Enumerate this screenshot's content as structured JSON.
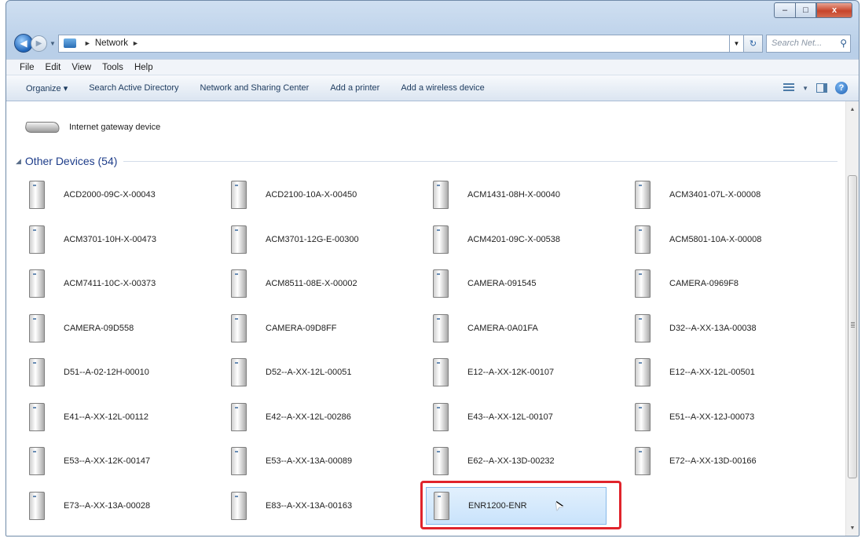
{
  "window": {
    "minimize_label": "–",
    "maximize_label": "□",
    "close_label": "x"
  },
  "address_bar": {
    "path_root_sep": "►",
    "location": "Network",
    "trailing_sep": "►",
    "search_placeholder": "Search Net..."
  },
  "menu": [
    "File",
    "Edit",
    "View",
    "Tools",
    "Help"
  ],
  "commands": [
    "Organize ▾",
    "Search Active Directory",
    "Network and Sharing Center",
    "Add a printer",
    "Add a wireless device"
  ],
  "gateway": {
    "label": "Internet gateway device"
  },
  "group": {
    "title": "Other Devices (54)",
    "chevron": "◢"
  },
  "devices": [
    "ACD2000-09C-X-00043",
    "ACD2100-10A-X-00450",
    "ACM1431-08H-X-00040",
    "ACM3401-07L-X-00008",
    "ACM3701-10H-X-00473",
    "ACM3701-12G-E-00300",
    "ACM4201-09C-X-00538",
    "ACM5801-10A-X-00008",
    "ACM7411-10C-X-00373",
    "ACM8511-08E-X-00002",
    "CAMERA-091545",
    "CAMERA-0969F8",
    "CAMERA-09D558",
    "CAMERA-09D8FF",
    "CAMERA-0A01FA",
    "D32--A-XX-13A-00038",
    "D51--A-02-12H-00010",
    "D52--A-XX-12L-00051",
    "E12--A-XX-12K-00107",
    "E12--A-XX-12L-00501",
    "E41--A-XX-12L-00112",
    "E42--A-XX-12L-00286",
    "E43--A-XX-12L-00107",
    "E51--A-XX-12J-00073",
    "E53--A-XX-12K-00147",
    "E53--A-XX-13A-00089",
    "E62--A-XX-13D-00232",
    "E72--A-XX-13D-00166",
    "E73--A-XX-13A-00028",
    "E83--A-XX-13A-00163",
    "ENR1200-ENR"
  ],
  "selected_device": "ENR1200-ENR",
  "colors": {
    "highlight": "#e0242c",
    "group_title": "#1e3d8a"
  }
}
